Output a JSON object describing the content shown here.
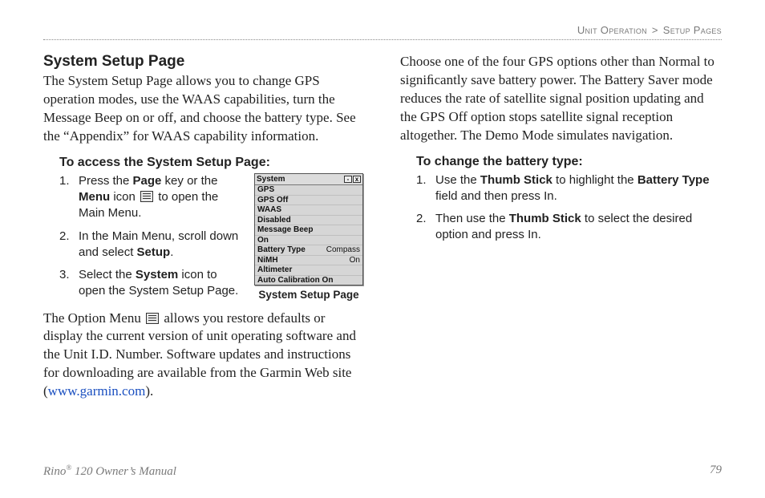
{
  "header": {
    "crumb_section": "Unit Operation",
    "crumb_sep": ">",
    "crumb_page": "Setup Pages"
  },
  "left": {
    "title": "System Setup Page",
    "intro": "The System Setup Page allows you to change GPS operation modes, use the WAAS capabilities, turn the Message Beep on or off, and choose the battery type. See the “Appendix” for WAAS capability information.",
    "sub1": "To access the System Setup Page:",
    "steps1": {
      "s1a": "Press the ",
      "s1b_bold": "Page",
      "s1c": " key or the ",
      "s1d_bold": "Menu",
      "s1e": " icon ",
      "s1f": " to open the Main Menu.",
      "s2a": "In the Main Menu, scroll down and select ",
      "s2b_bold": "Setup",
      "s2c": ".",
      "s3a": "Select the ",
      "s3b_bold": "System",
      "s3c": " icon to open the System Setup Page."
    },
    "figure": {
      "caption": "System Setup Page",
      "title": "System",
      "rows": [
        {
          "k": "GPS",
          "v": ""
        },
        {
          "k": "GPS Off",
          "v": ""
        },
        {
          "k": "WAAS",
          "v": ""
        },
        {
          "k": "Disabled",
          "v": ""
        },
        {
          "k": "Message Beep",
          "v": ""
        },
        {
          "k": "On",
          "v": ""
        },
        {
          "k": "Battery Type",
          "v": "Compass"
        },
        {
          "k": "NiMH",
          "v": "On"
        },
        {
          "k": "Altimeter",
          "v": ""
        },
        {
          "k": "Auto Calibration On",
          "v": ""
        }
      ]
    },
    "para2a": "The Option Menu ",
    "para2b": " allows you restore defaults or display the current version of unit operating software and the Unit I.D. Number. Software updates and instructions for downloading are available from the Garmin Web site (",
    "para2_link": "www.garmin.com",
    "para2c": ")."
  },
  "right": {
    "para1": "Choose one of the four GPS options other than Normal to signiﬁcantly save battery power. The Battery Saver mode reduces the rate of satellite signal position updating and the GPS Off option stops satellite signal reception altogether. The Demo Mode simulates navigation.",
    "sub1": "To change the battery type:",
    "steps1": {
      "s1a": "Use the ",
      "s1b_bold": "Thumb Stick",
      "s1c": " to highlight the ",
      "s1d_bold": "Battery Type",
      "s1e": " ﬁeld and then press In.",
      "s2a": "Then use the ",
      "s2b_bold": "Thumb Stick",
      "s2c": " to select the desired option and press In."
    }
  },
  "footer": {
    "product_a": "Rino",
    "product_sup": "®",
    "product_b": " 120 Owner’s Manual",
    "page_no": "79"
  }
}
